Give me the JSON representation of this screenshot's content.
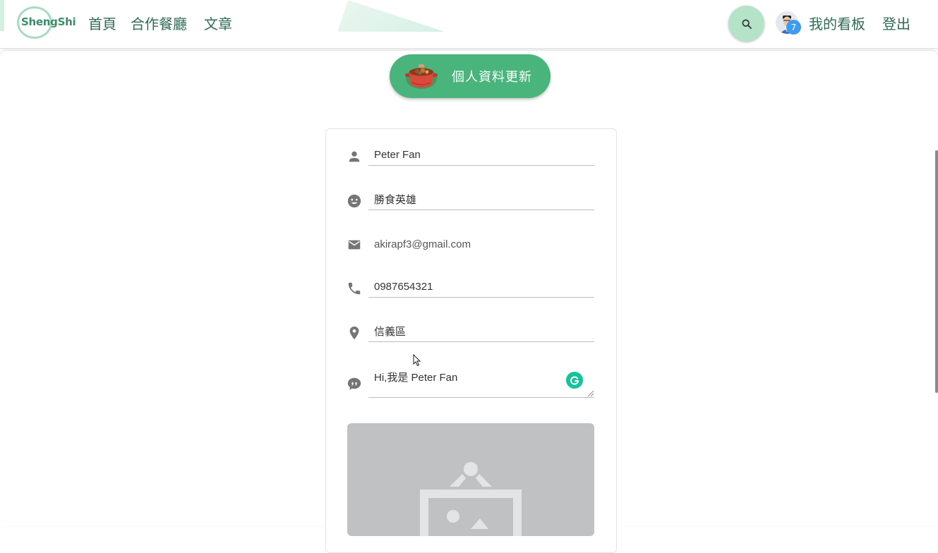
{
  "header": {
    "logo_text": "ShengShi",
    "nav": [
      {
        "label": "首頁"
      },
      {
        "label": "合作餐廳"
      },
      {
        "label": "文章"
      }
    ],
    "search_icon": "search-icon",
    "notification_count": "7",
    "dashboard_label": "我的看板",
    "logout_label": "登出"
  },
  "page": {
    "title": "個人資料更新"
  },
  "form": {
    "name": {
      "icon": "person-icon",
      "value": "Peter Fan"
    },
    "nickname": {
      "icon": "smiley-icon",
      "value": "勝食英雄"
    },
    "email": {
      "icon": "mail-icon",
      "value": "akirapf3@gmail.com"
    },
    "phone": {
      "icon": "phone-icon",
      "value": "0987654321"
    },
    "district": {
      "icon": "location-pin-icon",
      "value": "信義區"
    },
    "bio": {
      "icon": "chat-quote-icon",
      "value": "Hi,我是 Peter Fan"
    }
  },
  "colors": {
    "brand_green": "#49b57c",
    "nav_text": "#2f6b55",
    "search_bg": "#b5e3c7",
    "badge_blue": "#3d9cf0",
    "grammarly_green": "#15c39a"
  }
}
